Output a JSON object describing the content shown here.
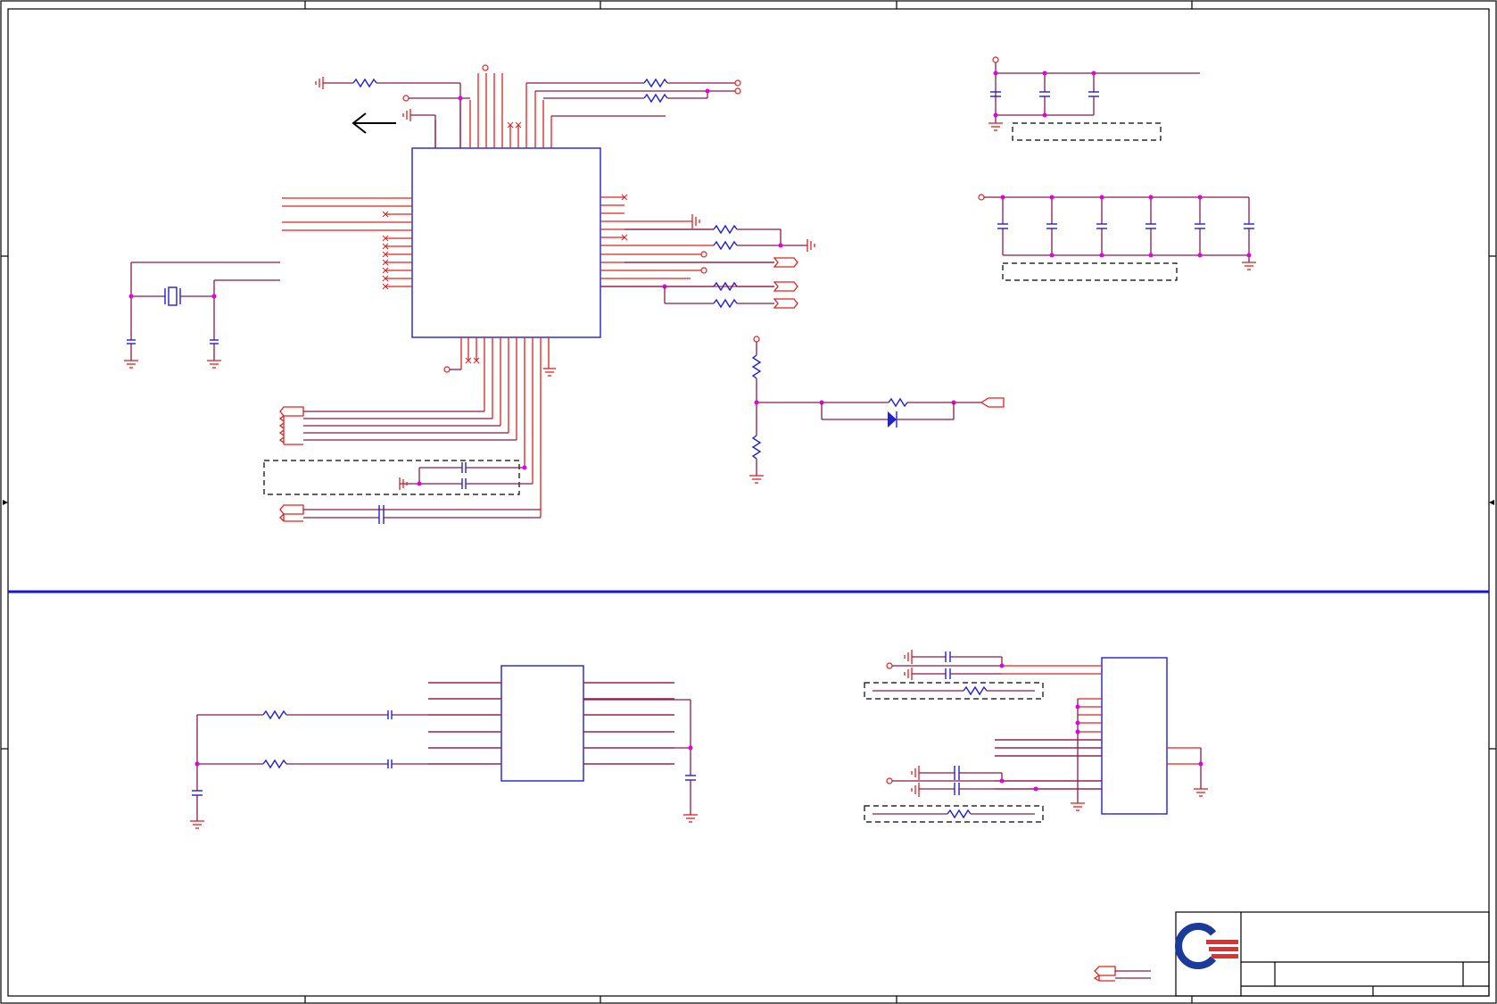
{
  "diagram": {
    "kind": "schematic",
    "colors": {
      "wire": "#8b1a4a",
      "pin": "#e0201c",
      "component": "#1f1fd6",
      "junction": "#e400e4",
      "divider": "#1313e8",
      "logo_blue": "#1a3a9c",
      "logo_red": "#e03030"
    },
    "icons": {
      "direction_arrow": "left-arrow-icon",
      "company_logo": "logo-mark"
    }
  }
}
